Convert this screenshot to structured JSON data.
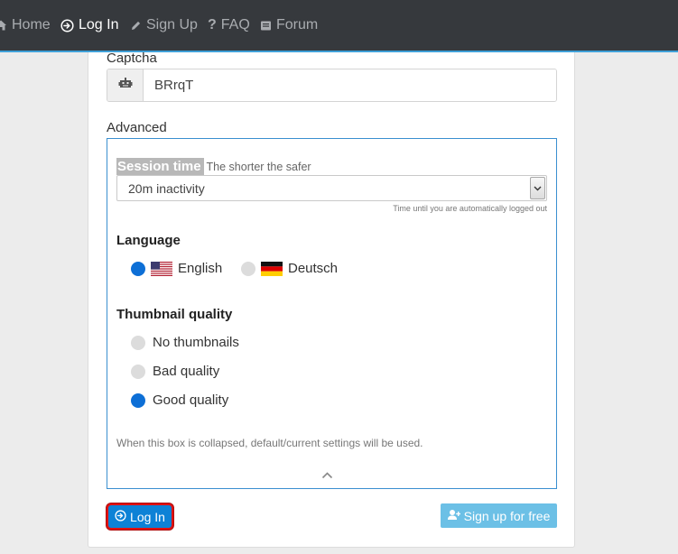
{
  "nav": {
    "home": "Home",
    "login": "Log In",
    "signup": "Sign Up",
    "faq": "FAQ",
    "forum": "Forum",
    "icons": [
      "home-icon",
      "login-icon",
      "pencil-icon",
      "question-icon",
      "forum-icon"
    ]
  },
  "form": {
    "captcha_label": "Captcha",
    "captcha_value": "BRrqT",
    "advanced_label": "Advanced",
    "session": {
      "title": "Session time",
      "hint": "The shorter the safer",
      "selected": "20m inactivity",
      "help": "Time until you are automatically logged out"
    },
    "language": {
      "title": "Language",
      "options": [
        {
          "label": "English",
          "selected": true,
          "flag": "us-flag-icon"
        },
        {
          "label": "Deutsch",
          "selected": false,
          "flag": "de-flag-icon"
        }
      ]
    },
    "thumbnail": {
      "title": "Thumbnail quality",
      "options": [
        {
          "label": "No thumbnails",
          "selected": false
        },
        {
          "label": "Bad quality",
          "selected": false
        },
        {
          "label": "Good quality",
          "selected": true
        }
      ]
    },
    "collapse_note": "When this box is collapsed, default/current settings will be used.",
    "login_button": "Log In",
    "signup_button": "Sign up for free"
  },
  "colors": {
    "nav_bg": "#36393d",
    "nav_accent": "#3fa0d8",
    "primary": "#0d82d6",
    "radio_on": "#0d6fd6",
    "focus_ring": "#e01111",
    "signup": "#6cc0e6"
  }
}
